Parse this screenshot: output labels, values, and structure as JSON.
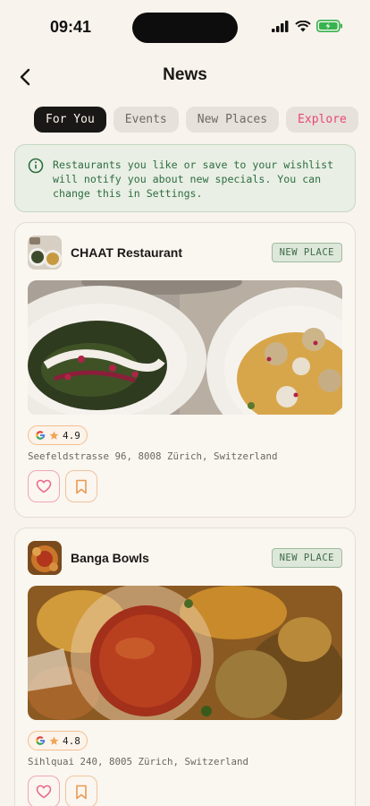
{
  "status_bar": {
    "time": "09:41"
  },
  "header": {
    "title": "News"
  },
  "tabs": [
    {
      "label": "For You"
    },
    {
      "label": "Events"
    },
    {
      "label": "New Places"
    },
    {
      "label": "Explore"
    }
  ],
  "info": {
    "line1": "Restaurants you like or save to your wishlist",
    "line2": "will notify you about new specials. You can",
    "line3": "change this in Settings."
  },
  "cards": [
    {
      "name": "CHAAT Restaurant",
      "badge": "NEW PLACE",
      "rating": "4.9",
      "address": "Seefeldstrasse 96, 8008 Zürich, Switzerland"
    },
    {
      "name": "Banga Bowls",
      "badge": "NEW PLACE",
      "rating": "4.8",
      "address": "Sihlquai 240, 8005 Zürich, Switzerland"
    }
  ],
  "colors": {
    "background": "#f8f3ec",
    "active_tab": "#1a1816",
    "explore_accent": "#e8467c",
    "info_text": "#2e6d43",
    "badge_text": "#3d6a48"
  },
  "icons": [
    "back-arrow-icon",
    "info-icon",
    "google-icon",
    "star-icon",
    "heart-icon",
    "bookmark-icon",
    "signal-icon",
    "wifi-icon",
    "battery-icon"
  ]
}
